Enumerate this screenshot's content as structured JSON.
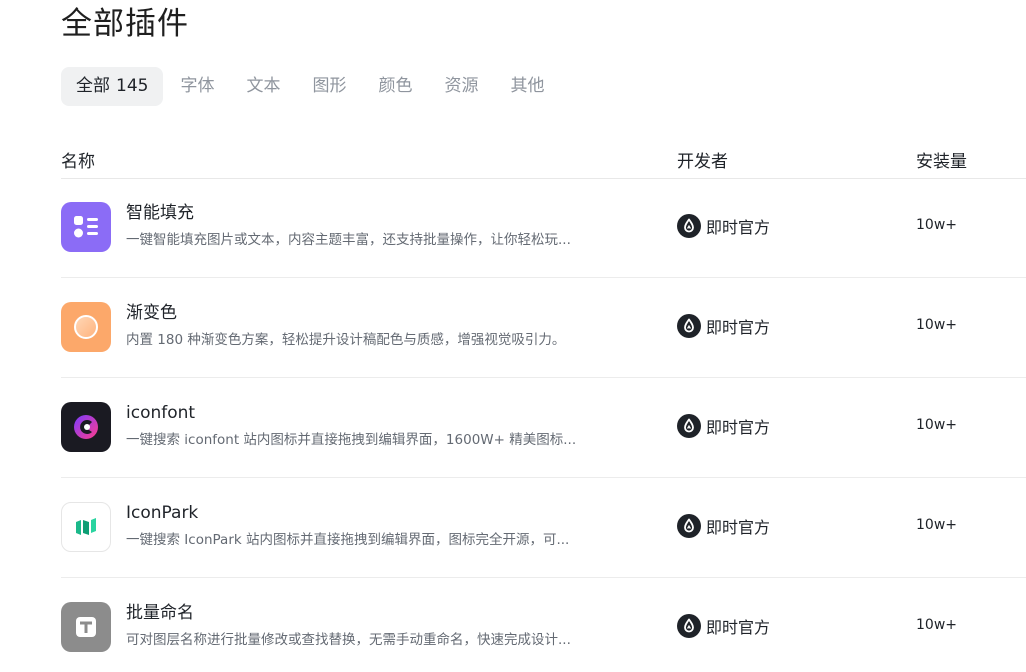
{
  "page_title": "全部插件",
  "tabs": [
    {
      "label": "全部",
      "count": "145"
    },
    {
      "label": "字体"
    },
    {
      "label": "文本"
    },
    {
      "label": "图形"
    },
    {
      "label": "颜色"
    },
    {
      "label": "资源"
    },
    {
      "label": "其他"
    }
  ],
  "table": {
    "headers": {
      "name": "名称",
      "developer": "开发者",
      "installs": "安装量"
    },
    "rows": [
      {
        "name": "智能填充",
        "description": "一键智能填充图片或文本，内容主题丰富，还支持批量操作，让你轻松玩...",
        "icon": "smart-fill-icon",
        "icon_color": "#8b6cf6",
        "developer": "即时官方",
        "installs": "10w+"
      },
      {
        "name": "渐变色",
        "description": "内置 180 种渐变色方案，轻松提升设计稿配色与质感，增强视觉吸引力。",
        "icon": "gradient-icon",
        "icon_color": "#fca86a",
        "developer": "即时官方",
        "installs": "10w+"
      },
      {
        "name": "iconfont",
        "description": "一键搜索 iconfont 站内图标并直接拖拽到编辑界面，1600W+ 精美图标...",
        "icon": "iconfont-icon",
        "icon_color": "#1a1a22",
        "developer": "即时官方",
        "installs": "10w+"
      },
      {
        "name": "IconPark",
        "description": "一键搜索 IconPark 站内图标并直接拖拽到编辑界面，图标完全开源，可...",
        "icon": "iconpark-icon",
        "icon_color": "#ffffff",
        "developer": "即时官方",
        "installs": "10w+"
      },
      {
        "name": "批量命名",
        "description": "可对图层名称进行批量修改或查找替换，无需手动重命名，快速完成设计...",
        "icon": "batch-rename-icon",
        "icon_color": "#8c8c8c",
        "developer": "即时官方",
        "installs": "10w+"
      }
    ]
  }
}
